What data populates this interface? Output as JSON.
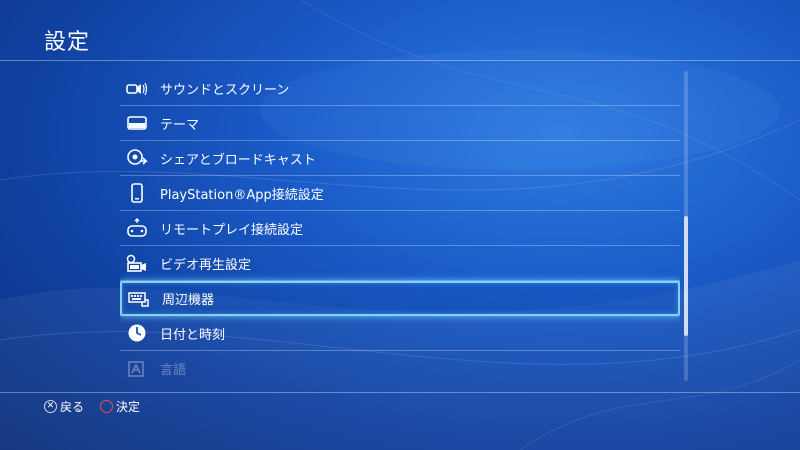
{
  "header": {
    "title": "設定"
  },
  "menu": {
    "items": [
      {
        "label": "サウンドとスクリーン",
        "icon": "speaker-screen-icon"
      },
      {
        "label": "テーマ",
        "icon": "theme-icon"
      },
      {
        "label": "シェアとブロードキャスト",
        "icon": "share-icon"
      },
      {
        "label": "PlayStation®App接続設定",
        "icon": "smartphone-icon"
      },
      {
        "label": "リモートプレイ接続設定",
        "icon": "remote-play-icon"
      },
      {
        "label": "ビデオ再生設定",
        "icon": "video-icon"
      },
      {
        "label": "周辺機器",
        "icon": "keyboard-icon",
        "selected": true
      },
      {
        "label": "日付と時刻",
        "icon": "clock-icon"
      },
      {
        "label": "言語",
        "icon": "language-icon"
      }
    ]
  },
  "scroll": {
    "position_fraction": 0.47
  },
  "footer": {
    "back_symbol": "✕",
    "back_label": "戻る",
    "confirm_symbol": "○",
    "confirm_label": "決定"
  },
  "colors": {
    "selection": "#7fd3ff",
    "background": "#1a5bc8",
    "confirm_button": "#e05050"
  }
}
